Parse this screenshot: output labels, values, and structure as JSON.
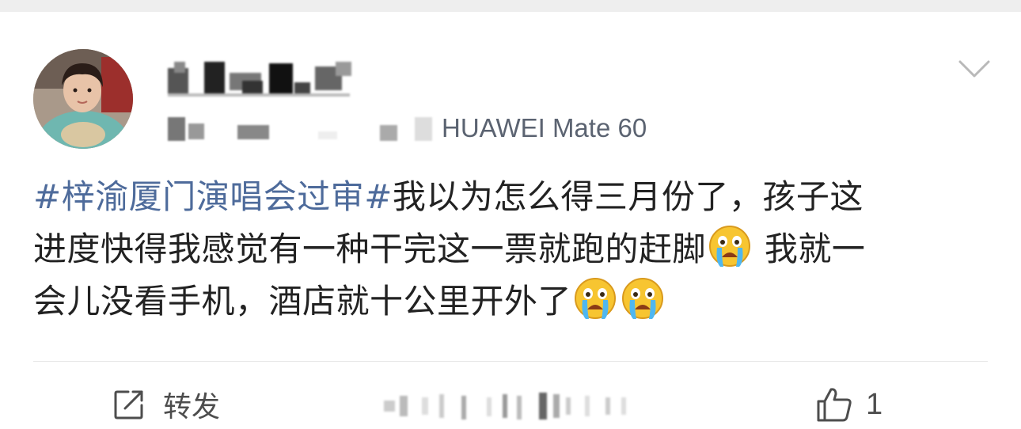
{
  "post": {
    "device_source": "HUAWEI Mate 60",
    "content_lines": [
      {
        "topic": "#梓渝厦门演唱会过审#",
        "text": "我以为怎么得三月份了，孩子这"
      },
      {
        "text_a": "进度快得我感觉有一种干完这一票就跑的赶脚",
        "text_b": " 我就一"
      },
      {
        "text": "会儿没看手机，酒店就十公里开外了"
      }
    ],
    "emoji_names": [
      "crying-face-emoji",
      "crying-face-emoji",
      "crying-face-emoji"
    ]
  },
  "actions": {
    "repost_label": "转发",
    "like_count": "1"
  },
  "colors": {
    "topic": "#4e6b9b",
    "text": "#222222",
    "meta": "#5b6371",
    "divider": "#e6e6e6"
  }
}
